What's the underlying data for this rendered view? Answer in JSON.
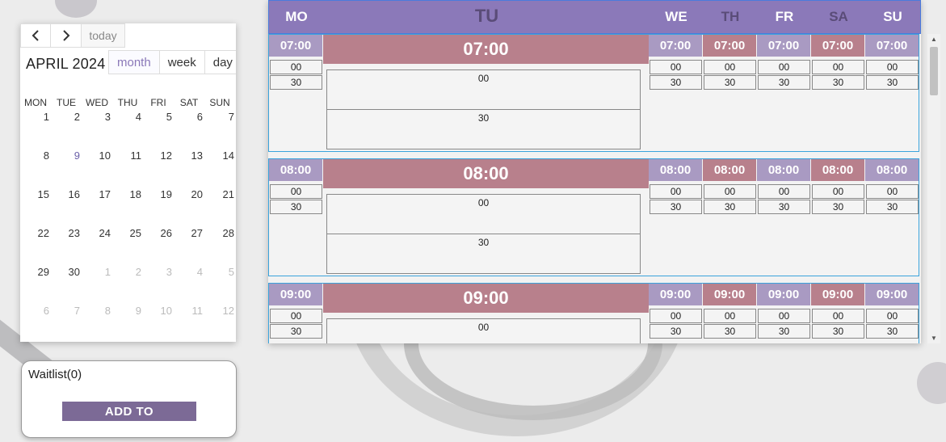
{
  "mini_calendar": {
    "prev_icon": "chevron-left-icon",
    "next_icon": "chevron-right-icon",
    "today_label": "today",
    "month_title": "APRIL 2024",
    "views": [
      "month",
      "week",
      "day"
    ],
    "active_view": "month",
    "weekdays": [
      "MON",
      "TUE",
      "WED",
      "THU",
      "FRI",
      "SAT",
      "SUN"
    ],
    "weeks": [
      [
        "1",
        "2",
        "3",
        "4",
        "5",
        "6",
        "7"
      ],
      [
        "8",
        "9",
        "10",
        "11",
        "12",
        "13",
        "14"
      ],
      [
        "15",
        "16",
        "17",
        "18",
        "19",
        "20",
        "21"
      ],
      [
        "22",
        "23",
        "24",
        "25",
        "26",
        "27",
        "28"
      ],
      [
        "29",
        "30",
        "1",
        "2",
        "3",
        "4",
        "5"
      ],
      [
        "6",
        "7",
        "8",
        "9",
        "10",
        "11",
        "12"
      ]
    ],
    "highlight_day": "9"
  },
  "waitlist": {
    "title": "Waitlist(0)",
    "add_button": "ADD TO"
  },
  "planner": {
    "days": [
      "MO",
      "TU",
      "WE",
      "TH",
      "FR",
      "SA",
      "SU"
    ],
    "hours": [
      "07:00",
      "08:00",
      "09:00"
    ],
    "slots": [
      "00",
      "30"
    ]
  },
  "colors": {
    "header": "#8b79b9",
    "hour_purple": "#a99ac2",
    "hour_pink": "#b8808c",
    "add_button": "#7c6a96",
    "border_blue": "#3aa3dc"
  }
}
